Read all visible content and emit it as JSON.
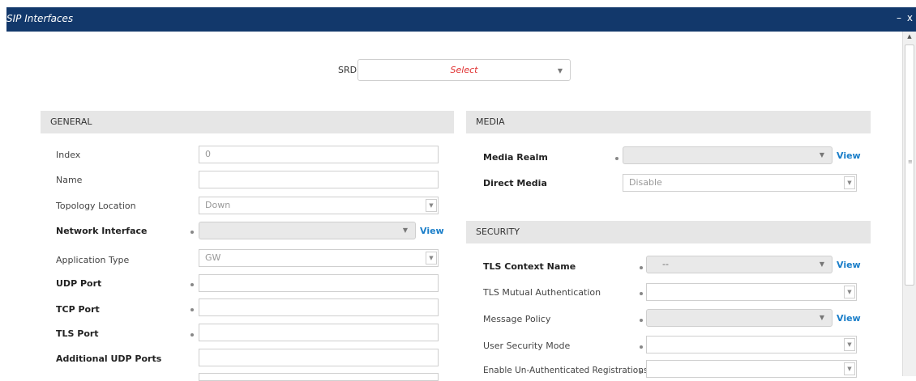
{
  "window": {
    "title": "SIP Interfaces",
    "minimize_label": "–",
    "close_label": "x"
  },
  "srd": {
    "label": "SRD",
    "value": "Select"
  },
  "general": {
    "header": "GENERAL",
    "index": {
      "label": "Index",
      "value": "0"
    },
    "name": {
      "label": "Name",
      "value": ""
    },
    "topology_location": {
      "label": "Topology Location",
      "value": "Down"
    },
    "network_interface": {
      "label": "Network Interface",
      "value": "",
      "link": "View"
    },
    "application_type": {
      "label": "Application Type",
      "value": "GW"
    },
    "udp_port": {
      "label": "UDP Port",
      "value": ""
    },
    "tcp_port": {
      "label": "TCP Port",
      "value": ""
    },
    "tls_port": {
      "label": "TLS Port",
      "value": ""
    },
    "additional_udp_ports": {
      "label": "Additional UDP Ports",
      "value": ""
    }
  },
  "media": {
    "header": "MEDIA",
    "media_realm": {
      "label": "Media Realm",
      "value": "",
      "link": "View"
    },
    "direct_media": {
      "label": "Direct Media",
      "value": "Disable"
    }
  },
  "security": {
    "header": "SECURITY",
    "tls_context_name": {
      "label": "TLS Context Name",
      "value": "--",
      "link": "View"
    },
    "tls_mutual_auth": {
      "label": "TLS Mutual Authentication",
      "value": ""
    },
    "message_policy": {
      "label": "Message Policy",
      "value": "",
      "link": "View"
    },
    "user_security_mode": {
      "label": "User Security Mode",
      "value": ""
    },
    "enable_unauth_registrations": {
      "label": "Enable Un-Authenticated Registrations",
      "value": ""
    }
  },
  "colors": {
    "titlebar": "#12386b",
    "link": "#1a7ec9",
    "select_placeholder": "#e03030",
    "section_bg": "#e6e6e6"
  },
  "icons": {
    "dropdown": "chevron-down-icon",
    "required": "required-dot-icon"
  }
}
